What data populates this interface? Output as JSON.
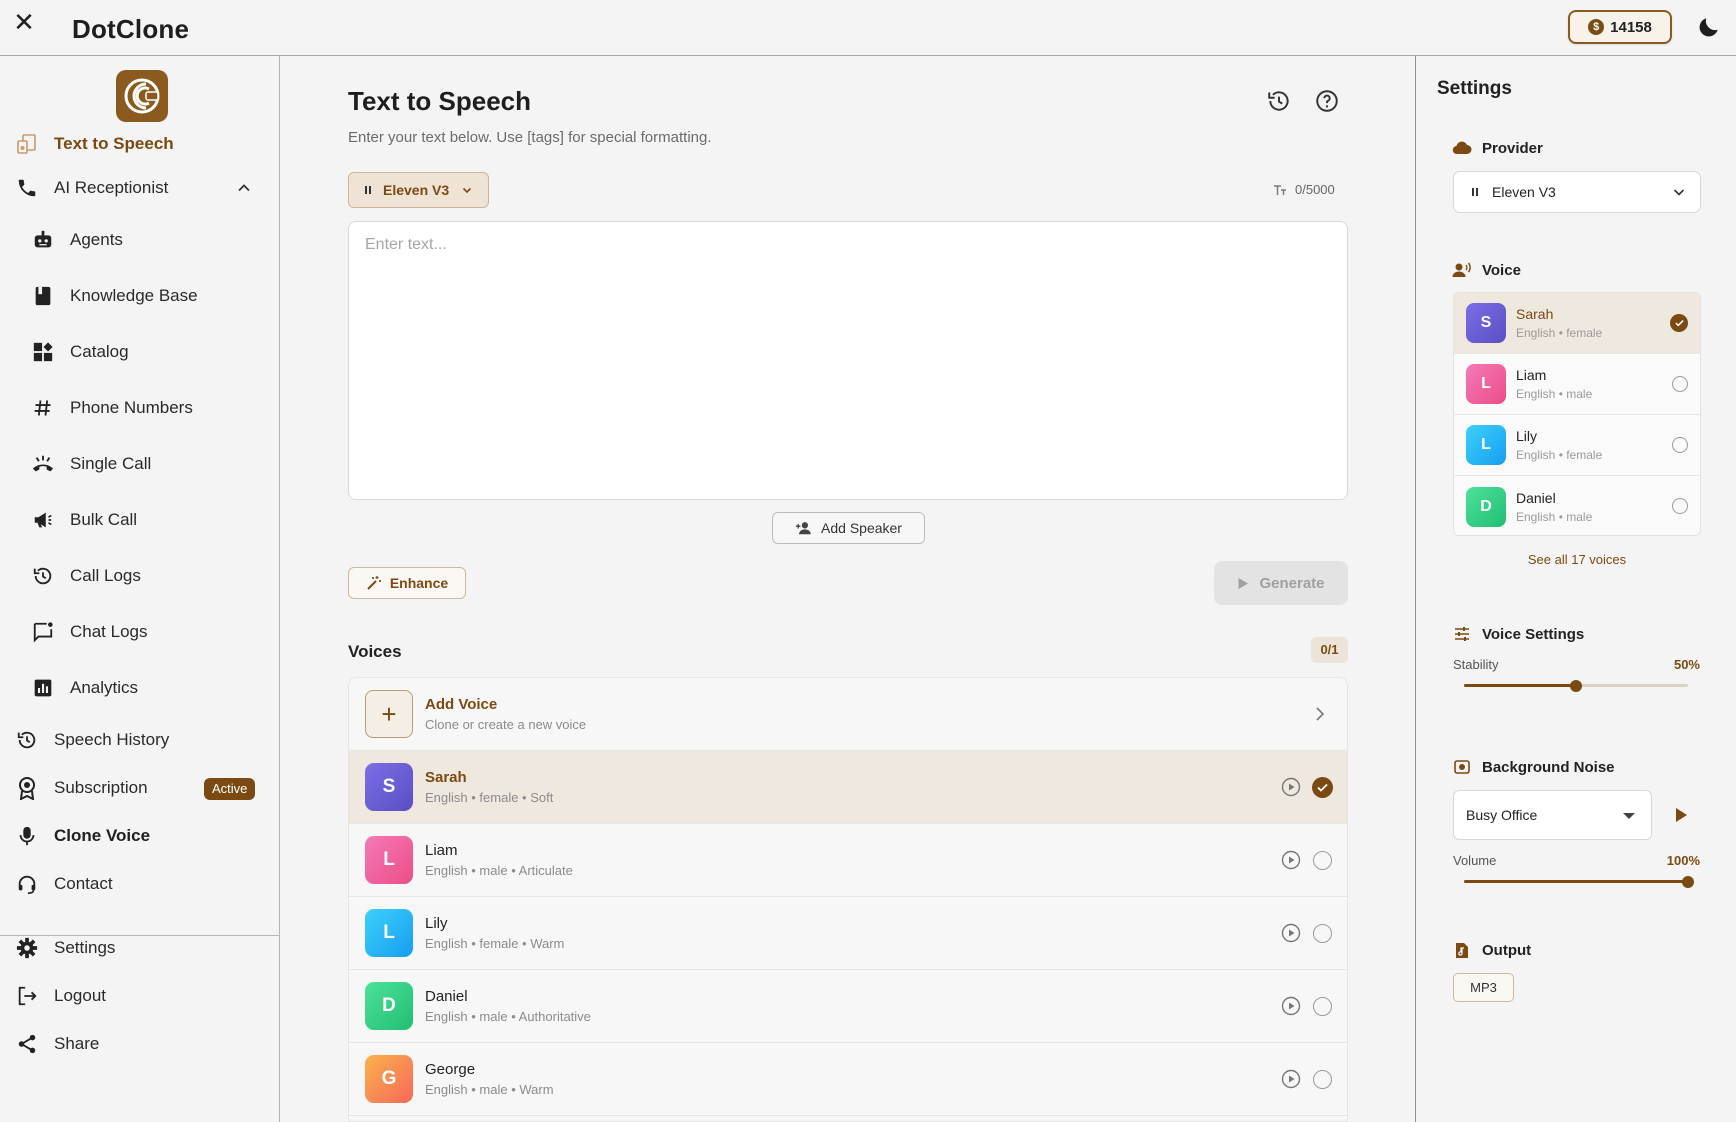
{
  "app": {
    "title": "DotClone",
    "credits": "14158",
    "coin_symbol": "$"
  },
  "sidebar": {
    "items": [
      {
        "label": "Text to Speech",
        "icon": "tts-icon"
      },
      {
        "label": "AI Receptionist",
        "icon": "phone-icon"
      },
      {
        "label": "Agents",
        "icon": "robot-icon"
      },
      {
        "label": "Knowledge Base",
        "icon": "book-icon"
      },
      {
        "label": "Catalog",
        "icon": "widgets-icon"
      },
      {
        "label": "Phone Numbers",
        "icon": "hash-icon"
      },
      {
        "label": "Single Call",
        "icon": "call-ringing-icon"
      },
      {
        "label": "Bulk Call",
        "icon": "megaphone-icon"
      },
      {
        "label": "Call Logs",
        "icon": "history-icon"
      },
      {
        "label": "Chat Logs",
        "icon": "chat-icon"
      },
      {
        "label": "Analytics",
        "icon": "analytics-icon"
      },
      {
        "label": "Speech History",
        "icon": "history-icon"
      },
      {
        "label": "Subscription",
        "icon": "award-icon",
        "badge": "Active"
      },
      {
        "label": "Clone Voice",
        "icon": "mic-icon"
      },
      {
        "label": "Contact",
        "icon": "support-icon"
      },
      {
        "label": "Settings",
        "icon": "gear-icon"
      },
      {
        "label": "Logout",
        "icon": "logout-icon"
      },
      {
        "label": "Share",
        "icon": "share-icon"
      }
    ]
  },
  "main": {
    "title": "Text to Speech",
    "subtitle": "Enter your text below. Use [tags] for special formatting.",
    "model_label": "Eleven V3",
    "char_count": "0/5000",
    "text_placeholder": "Enter text...",
    "add_speaker_label": "Add Speaker",
    "enhance_label": "Enhance",
    "generate_label": "Generate",
    "voices_title": "Voices",
    "voices_count": "0/1",
    "add_voice": {
      "name": "Add Voice",
      "desc": "Clone or create a new voice"
    },
    "voices": [
      {
        "initial": "S",
        "name": "Sarah",
        "desc": "English • female • Soft",
        "selected": true
      },
      {
        "initial": "L",
        "name": "Liam",
        "desc": "English • male • Articulate",
        "selected": false
      },
      {
        "initial": "L",
        "name": "Lily",
        "desc": "English • female • Warm",
        "selected": false
      },
      {
        "initial": "D",
        "name": "Daniel",
        "desc": "English • male • Authoritative",
        "selected": false
      },
      {
        "initial": "G",
        "name": "George",
        "desc": "English • male • Warm",
        "selected": false
      }
    ]
  },
  "settings": {
    "title": "Settings",
    "provider_heading": "Provider",
    "provider_value": "Eleven V3",
    "voice_heading": "Voice",
    "voices": [
      {
        "initial": "S",
        "name": "Sarah",
        "desc": "English • female",
        "selected": true
      },
      {
        "initial": "L",
        "name": "Liam",
        "desc": "English • male",
        "selected": false
      },
      {
        "initial": "L",
        "name": "Lily",
        "desc": "English • female",
        "selected": false
      },
      {
        "initial": "D",
        "name": "Daniel",
        "desc": "English • male",
        "selected": false
      }
    ],
    "see_all_label": "See all 17 voices",
    "voice_settings_heading": "Voice Settings",
    "stability_label": "Stability",
    "stability_value": "50%",
    "stability_fraction": 0.5,
    "bg_noise_heading": "Background Noise",
    "bg_noise_value": "Busy Office",
    "volume_label": "Volume",
    "volume_value": "100%",
    "volume_fraction": 1.0,
    "output_heading": "Output",
    "output_format": "MP3"
  },
  "colors": {
    "accent": "#7a4a12",
    "avatar_sarah": "#6f60d8",
    "avatar_liam": "#f0609e",
    "avatar_lily": "#2ab8f4",
    "avatar_daniel": "#2fcf7f",
    "avatar_george": "#f8864c"
  }
}
